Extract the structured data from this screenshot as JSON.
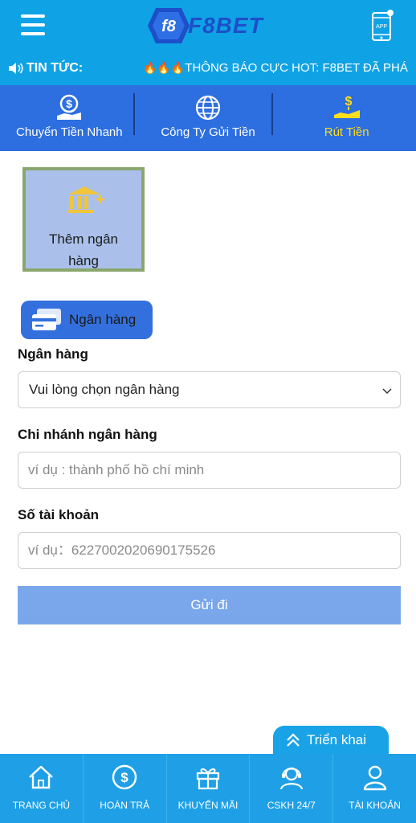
{
  "header": {
    "logo_text": "F8BET",
    "logo_badge": "f8",
    "app_label": "APP"
  },
  "news": {
    "label": "TIN TỨC:",
    "fire": "🔥🔥🔥",
    "text": "THÔNG BÁO CỰC HOT: F8BET ĐÃ PHÁ"
  },
  "tabs": [
    {
      "label": "Chuyển Tiền Nhanh",
      "icon": "dollar-hand-icon"
    },
    {
      "label": "Công Ty Gửi Tiền",
      "icon": "globe-icon"
    },
    {
      "label": "Rút Tiền",
      "icon": "withdraw-icon",
      "active": true
    }
  ],
  "add_bank": {
    "line1": "Thêm ngân",
    "line2": "hàng"
  },
  "bank_chip": {
    "label": "Ngân hàng"
  },
  "form": {
    "bank": {
      "label": "Ngân hàng",
      "value": "Vui lòng chọn ngân hàng"
    },
    "branch": {
      "label": "Chi nhánh ngân hàng",
      "placeholder": "ví dụ : thành phố hồ chí minh"
    },
    "account": {
      "label": "Số tài khoản",
      "placeholder": "ví dụ：6227002020690175526"
    },
    "submit_label": "Gửi đi"
  },
  "expand": {
    "label": "Triển khai"
  },
  "bottom_nav": [
    {
      "label": "TRANG CHỦ",
      "icon": "home-icon"
    },
    {
      "label": "HOÀN TRẢ",
      "icon": "dollar-circle-icon"
    },
    {
      "label": "KHUYẾN MÃI",
      "icon": "gift-icon"
    },
    {
      "label": "CSKH 24/7",
      "icon": "support-agent-icon"
    },
    {
      "label": "TÀI KHOẢN",
      "icon": "user-icon"
    }
  ],
  "colors": {
    "header_bg": "#0fa3e6",
    "tab_bg": "#2d6ee0",
    "active_tab": "#ffde1a",
    "submit_bg": "#7aa7ec",
    "nav_bg": "#1fa0e6"
  }
}
